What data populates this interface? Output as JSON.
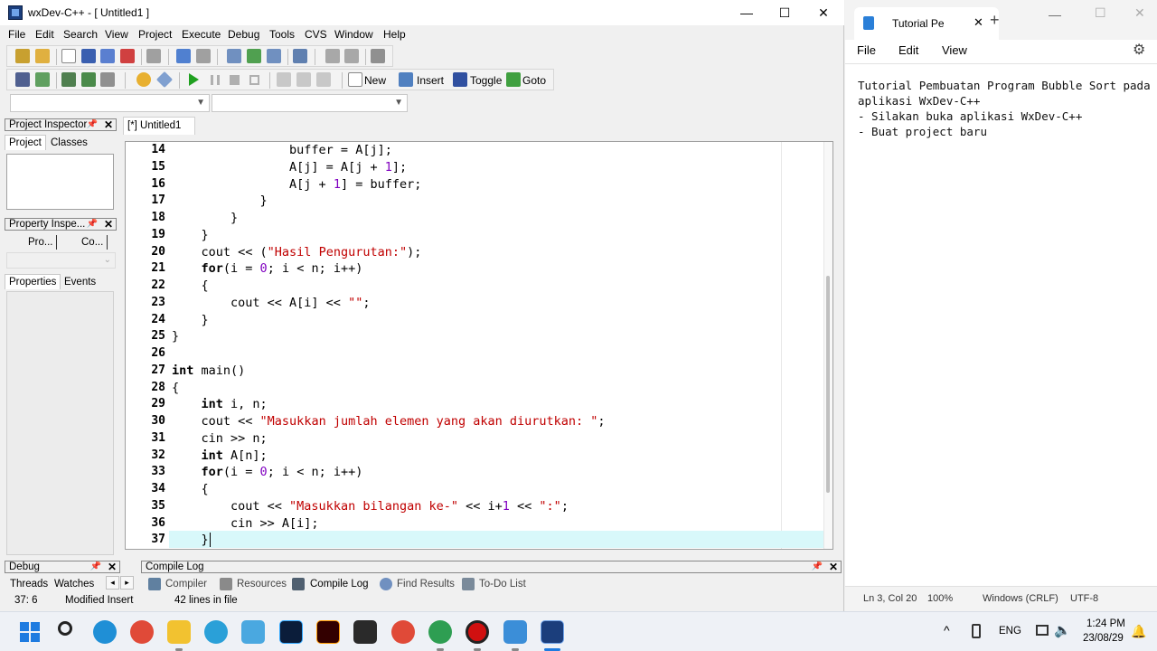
{
  "devcpp": {
    "window_title": "wxDev-C++  - [ Untitled1 ]",
    "controls": {
      "minimize": "—",
      "maximize": "☐",
      "close": "✕"
    },
    "menu": [
      "File",
      "Edit",
      "Search",
      "View",
      "Project",
      "Execute",
      "Debug",
      "Tools",
      "CVS",
      "Window",
      "Help"
    ],
    "toolbar2": {
      "new": "New",
      "insert": "Insert",
      "toggle": "Toggle",
      "goto": "Goto"
    },
    "left_panels": {
      "project_inspector": "Project Inspector",
      "project_tabs": [
        "Project",
        "Classes"
      ],
      "property_inspector": "Property Inspe...",
      "property_subtabs": [
        "Pro...",
        "Co..."
      ],
      "props_tabs": [
        "Properties",
        "Events"
      ]
    },
    "editor_tab": "[*] Untitled1",
    "code_lines": [
      {
        "n": "14",
        "html": "                buffer = A[j];"
      },
      {
        "n": "15",
        "html": "                A[j] = A[j + <span class=\"num\">1</span>];"
      },
      {
        "n": "16",
        "html": "                A[j + <span class=\"num\">1</span>] = buffer;"
      },
      {
        "n": "17",
        "html": "            }"
      },
      {
        "n": "18",
        "html": "        }"
      },
      {
        "n": "19",
        "html": "    }"
      },
      {
        "n": "20",
        "html": "    cout &lt;&lt; (<span class=\"str\">\"Hasil Pengurutan:\"</span>);"
      },
      {
        "n": "21",
        "html": "    <span class=\"kw\">for</span>(i = <span class=\"num\">0</span>; i &lt; n; i++)"
      },
      {
        "n": "22",
        "html": "    {"
      },
      {
        "n": "23",
        "html": "        cout &lt;&lt; A[i] &lt;&lt; <span class=\"str\">\"\"</span>;"
      },
      {
        "n": "24",
        "html": "    }"
      },
      {
        "n": "25",
        "html": "}"
      },
      {
        "n": "26",
        "html": ""
      },
      {
        "n": "27",
        "html": "<span class=\"kw\">int</span> main()"
      },
      {
        "n": "28",
        "html": "{"
      },
      {
        "n": "29",
        "html": "    <span class=\"kw\">int</span> i, n;"
      },
      {
        "n": "30",
        "html": "    cout &lt;&lt; <span class=\"str\">\"Masukkan jumlah elemen yang akan diurutkan: \"</span>;"
      },
      {
        "n": "31",
        "html": "    cin &gt;&gt; n;"
      },
      {
        "n": "32",
        "html": "    <span class=\"kw\">int</span> A[n];"
      },
      {
        "n": "33",
        "html": "    <span class=\"kw\">for</span>(i = <span class=\"num\">0</span>; i &lt; n; i++)"
      },
      {
        "n": "34",
        "html": "    {"
      },
      {
        "n": "35",
        "html": "        cout &lt;&lt; <span class=\"str\">\"Masukkan bilangan ke-\"</span> &lt;&lt; i+<span class=\"num\">1</span> &lt;&lt; <span class=\"str\">\":\"</span>;"
      },
      {
        "n": "36",
        "html": "        cin &gt;&gt; A[i];"
      },
      {
        "n": "37",
        "html": "    }"
      }
    ],
    "bottom": {
      "debug_title": "Debug",
      "debug_tabs": [
        "Threads",
        "Watches"
      ],
      "compile_log_title": "Compile Log",
      "bottom_tabs": [
        "Compiler",
        "Resources",
        "Compile Log",
        "Find Results",
        "To-Do List"
      ]
    },
    "status": {
      "pos": "37: 6",
      "mode": "Modified Insert",
      "lines": "42 lines in file"
    }
  },
  "notepad": {
    "tab_title": "Tutorial Pe",
    "menu": [
      "File",
      "Edit",
      "View"
    ],
    "text": "Tutorial Pembuatan Program Bubble Sort pada\naplikasi WxDev-C++\n- Silakan buka aplikasi WxDev-C++\n- Buat project baru",
    "status": {
      "position": "Ln 3, Col 20",
      "zoom": "100%",
      "eol": "Windows (CRLF)",
      "encoding": "UTF-8"
    }
  },
  "taskbar": {
    "lang": "ENG",
    "time": "1:24 PM",
    "date": "23/08/29"
  }
}
